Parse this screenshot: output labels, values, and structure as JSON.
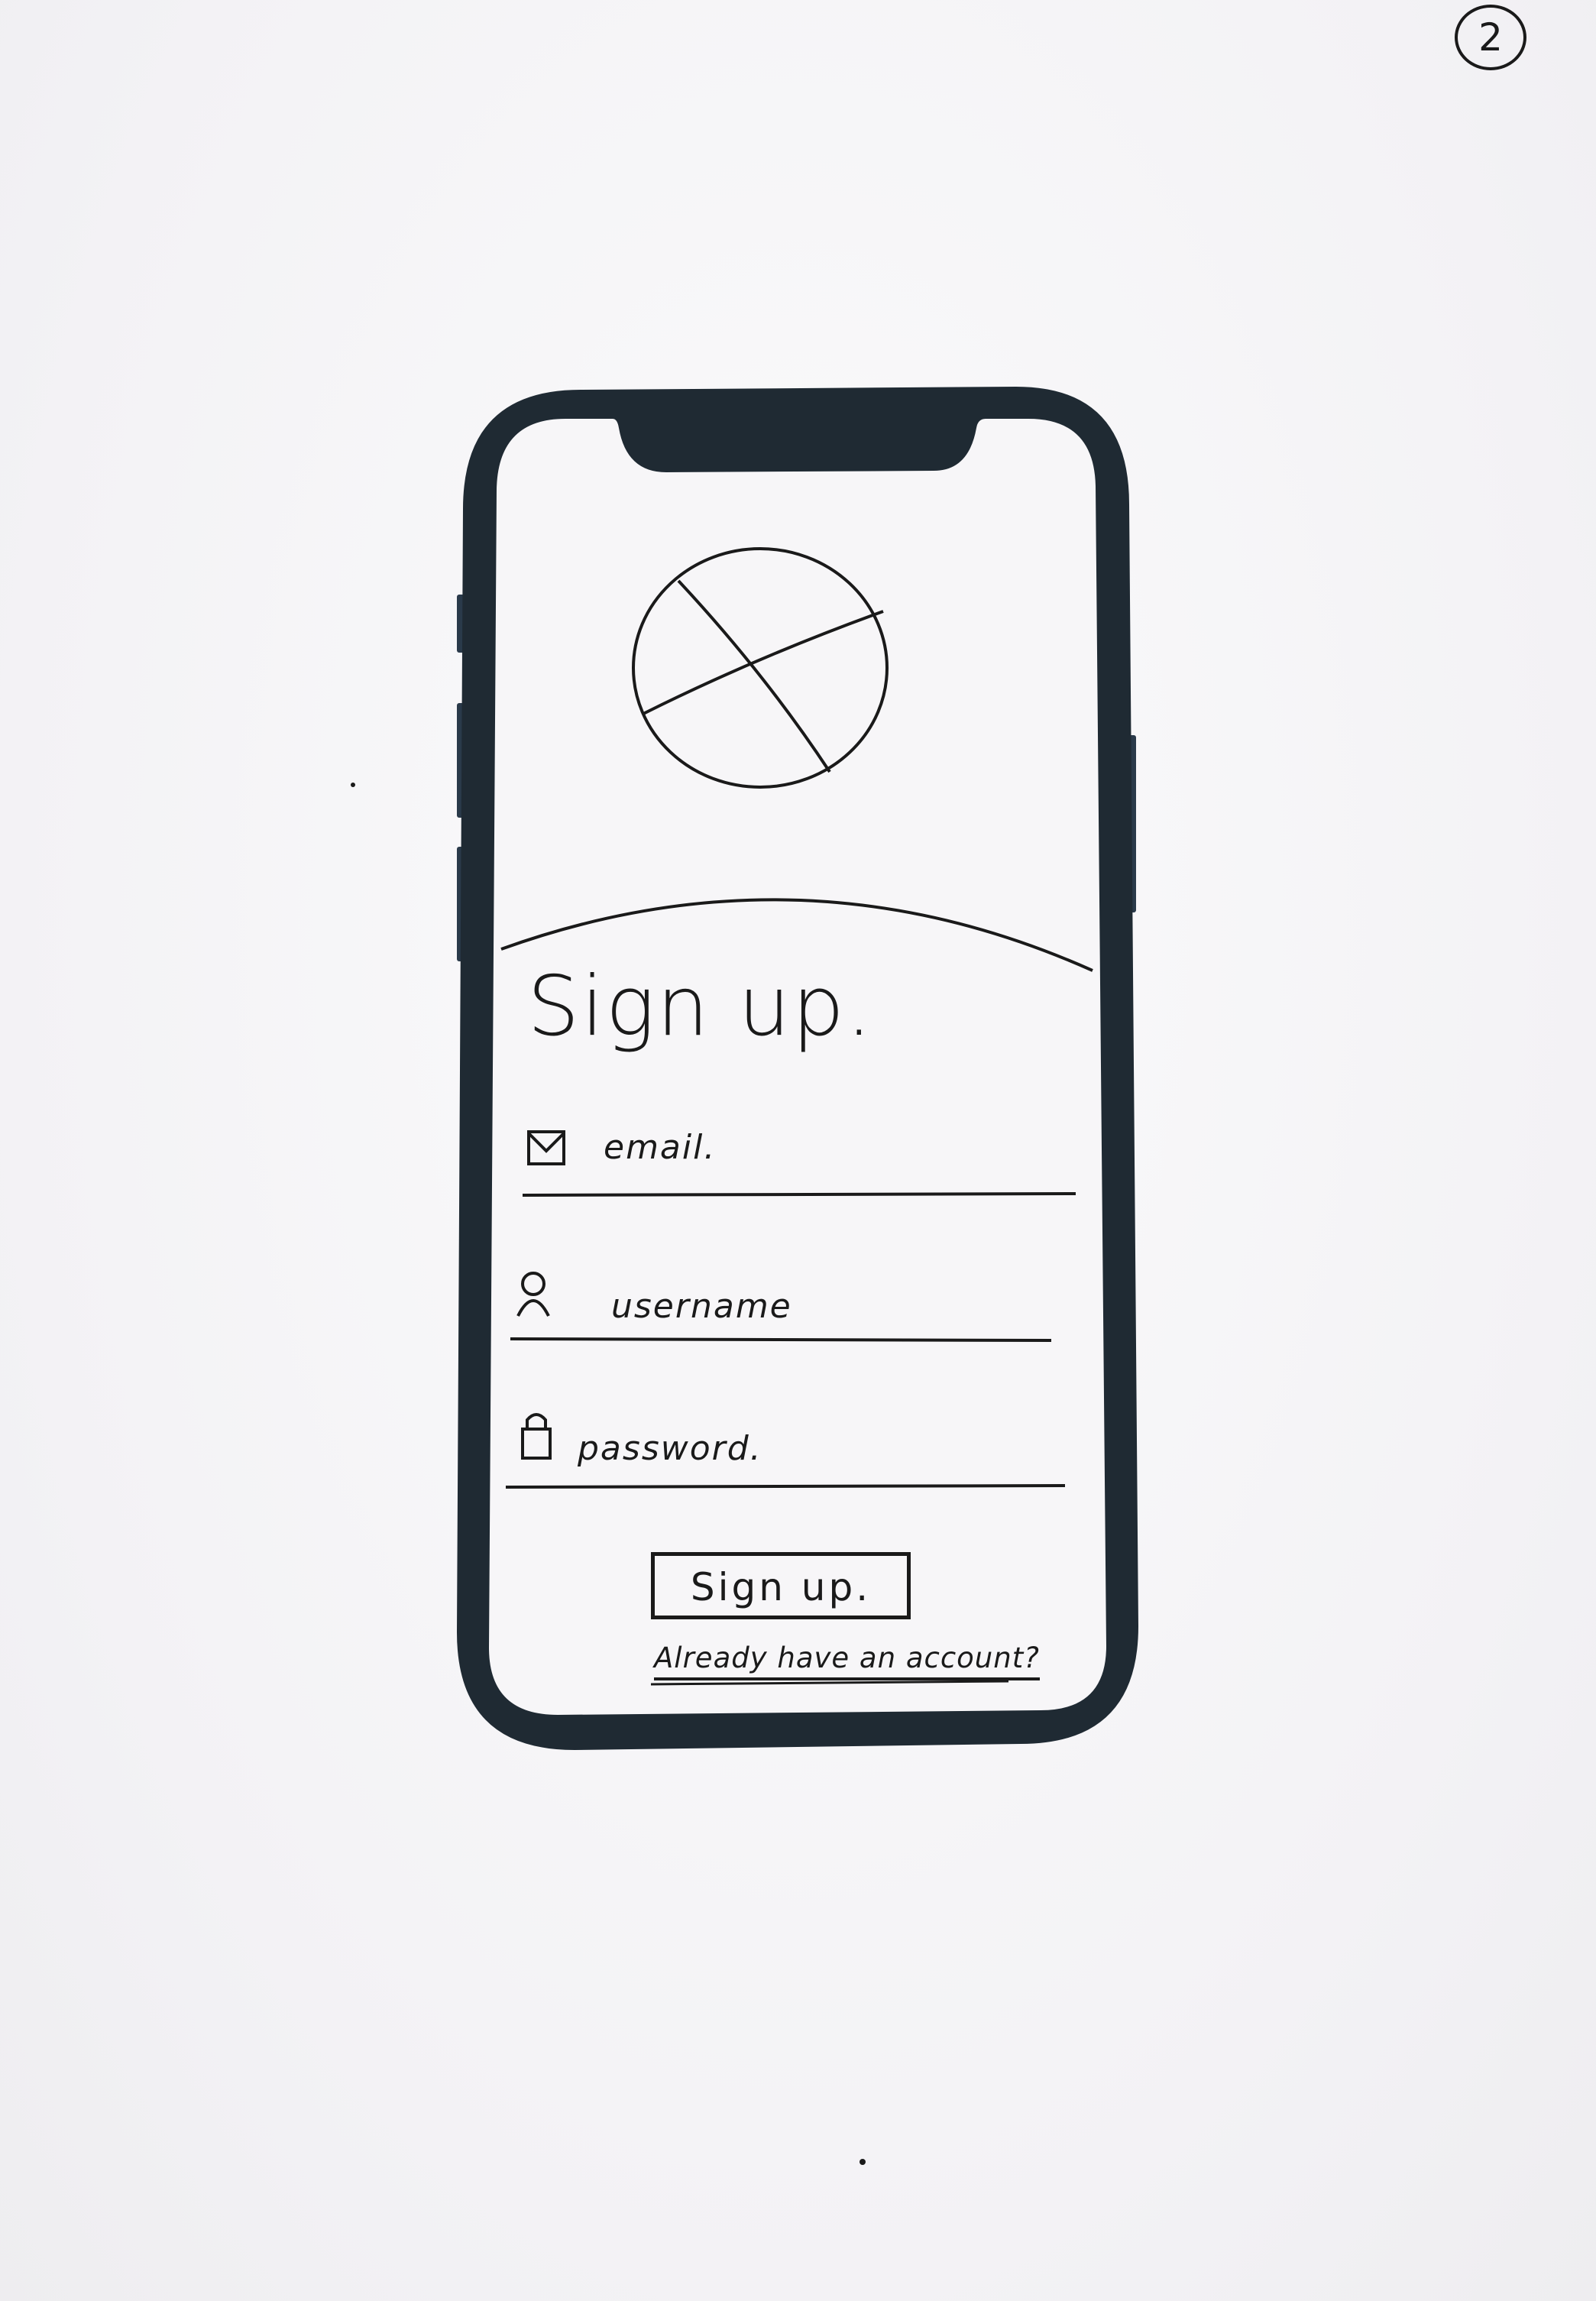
{
  "page_number": "2",
  "screen": {
    "title": "Sign up.",
    "image_placeholder_icon": "crossed-circle-placeholder"
  },
  "form": {
    "email": {
      "placeholder": "email.",
      "icon": "envelope-icon"
    },
    "username": {
      "placeholder": "username",
      "icon": "person-icon"
    },
    "password": {
      "placeholder": "password.",
      "icon": "lock-icon"
    }
  },
  "actions": {
    "submit_label": "Sign up.",
    "login_link": "Already have an account?"
  },
  "colors": {
    "phone_frame": "#1f2a33",
    "ink": "#1a1a1a",
    "paper": "#f7f6f8"
  }
}
